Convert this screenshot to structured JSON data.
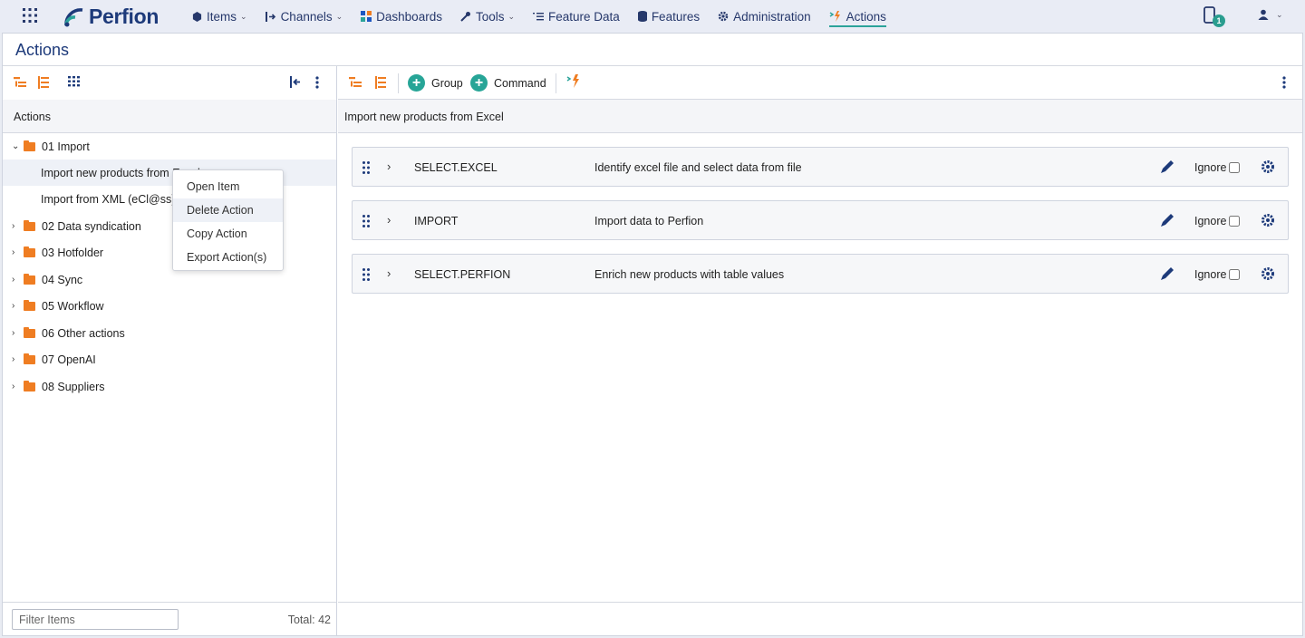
{
  "nav": {
    "items": [
      {
        "label": "Items",
        "has_menu": true,
        "icon": "cube-icon"
      },
      {
        "label": "Channels",
        "has_menu": true,
        "icon": "channels-icon"
      },
      {
        "label": "Dashboards",
        "has_menu": false,
        "icon": "dashboard-icon"
      },
      {
        "label": "Tools",
        "has_menu": true,
        "icon": "wrench-icon"
      },
      {
        "label": "Feature Data",
        "has_menu": false,
        "icon": "list-icon"
      },
      {
        "label": "Features",
        "has_menu": false,
        "icon": "database-icon"
      },
      {
        "label": "Administration",
        "has_menu": false,
        "icon": "gear-icon"
      },
      {
        "label": "Actions",
        "has_menu": false,
        "icon": "actions-icon",
        "active": true
      }
    ],
    "logo": "Perfion",
    "notification_count": "1"
  },
  "page": {
    "title": "Actions"
  },
  "left": {
    "header": "Actions",
    "tree": [
      {
        "label": "01 Import",
        "type": "folder",
        "expanded": true
      },
      {
        "label": "Import new products from Excel",
        "type": "item",
        "selected": true
      },
      {
        "label": "Import from XML (eCl@ss)",
        "type": "item"
      },
      {
        "label": "02 Data syndication",
        "type": "folder"
      },
      {
        "label": "03 Hotfolder",
        "type": "folder"
      },
      {
        "label": "04 Sync",
        "type": "folder"
      },
      {
        "label": "05 Workflow",
        "type": "folder"
      },
      {
        "label": "06 Other actions",
        "type": "folder"
      },
      {
        "label": "07 OpenAI",
        "type": "folder"
      },
      {
        "label": "08 Suppliers",
        "type": "folder"
      }
    ],
    "filter_placeholder": "Filter Items",
    "total": "Total: 42"
  },
  "context_menu": {
    "items": [
      "Open Item",
      "Delete Action",
      "Copy Action",
      "Export Action(s)"
    ],
    "hovered": "Delete Action"
  },
  "right": {
    "toolbar": {
      "group_label": "Group",
      "command_label": "Command"
    },
    "header": "Import new products from Excel",
    "commands": [
      {
        "name": "SELECT.EXCEL",
        "description": "Identify excel file and select data from file",
        "ignore_label": "Ignore"
      },
      {
        "name": "IMPORT",
        "description": "Import data to Perfion",
        "ignore_label": "Ignore"
      },
      {
        "name": "SELECT.PERFION",
        "description": "Enrich new products with table values",
        "ignore_label": "Ignore"
      }
    ]
  },
  "colors": {
    "brand": "#1d3a7a",
    "accent": "#27a597",
    "folder": "#ef7d22"
  }
}
